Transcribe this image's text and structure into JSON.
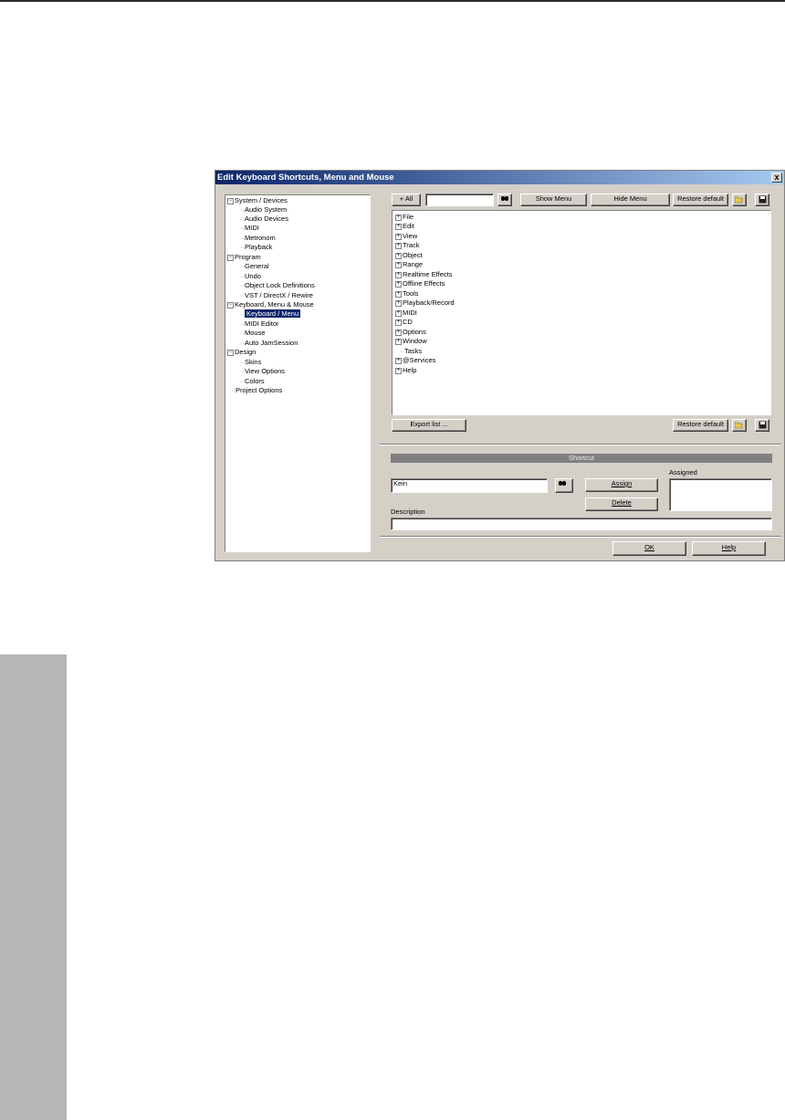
{
  "dialog": {
    "title": "Edit Keyboard Shortcuts, Menu and Mouse",
    "close_label": "x"
  },
  "tree": {
    "system_devices": "System / Devices",
    "audio_system": "Audio System",
    "audio_devices": "Audio Devices",
    "midi": "MIDI",
    "metronom": "Metronom",
    "playback": "Playback",
    "program": "Program",
    "general": "General",
    "undo": "Undo",
    "object_lock": "Object Lock Definitions",
    "vst": "VST / DirectX / Rewire",
    "keyboard_menu_mouse": "Keyboard, Menu & Mouse",
    "keyboard_menu": "Keyboard / Menu",
    "midi_editor": "MIDI Editor",
    "mouse": "Mouse",
    "auto_jam": "Auto JamSession",
    "design": "Design",
    "skins": "Skins",
    "view_options": "View Options",
    "colors": "Colors",
    "project_options": "Project Options",
    "expand_minus": "−"
  },
  "toolbar": {
    "plus_all": "+ All",
    "search_value": "",
    "show_menu": "Show Menu",
    "hide_menu": "Hide Menu",
    "restore_default": "Restore default"
  },
  "menu_items": {
    "plus": "+",
    "file": "File",
    "edit": "Edit",
    "view": "View",
    "track": "Track",
    "object": "Object",
    "range": "Range",
    "realtime_effects": "Realtime Effects",
    "offline_effects": "Offline Effects",
    "tools": "Tools",
    "playback_record": "Playback/Record",
    "midi": "MIDI",
    "cd": "CD",
    "options": "Options",
    "window": "Window",
    "tasks": "Tasks",
    "services": "@Services",
    "help": "Help"
  },
  "lower": {
    "export_list": "Export list ...",
    "restore_default": "Restore default"
  },
  "shortcut": {
    "section_title": "Shortcut",
    "assigned_label": "Assigned",
    "value": "Kein",
    "assign": "Assign",
    "delete": "Delete",
    "description_label": "Description",
    "description_value": ""
  },
  "footer": {
    "ok": "OK",
    "help": "Help"
  }
}
